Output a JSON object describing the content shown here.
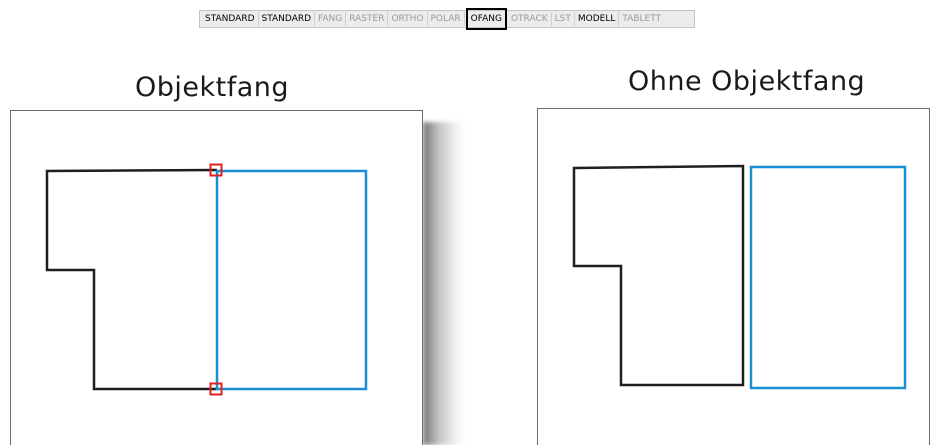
{
  "statusbar": {
    "buttons": [
      {
        "label": "STANDARD",
        "state": "on"
      },
      {
        "label": "STANDARD",
        "state": "on"
      },
      {
        "label": "FANG",
        "state": "off"
      },
      {
        "label": "RASTER",
        "state": "off"
      },
      {
        "label": "ORTHO",
        "state": "off"
      },
      {
        "label": "POLAR",
        "state": "off"
      },
      {
        "label": "OFANG",
        "state": "highlight"
      },
      {
        "label": "OTRACK",
        "state": "off"
      },
      {
        "label": "LST",
        "state": "off"
      },
      {
        "label": "MODELL",
        "state": "on"
      },
      {
        "label": "TABLETT",
        "state": "off"
      }
    ]
  },
  "left_panel": {
    "title": "Objektfang"
  },
  "right_panel": {
    "title": "Ohne Objektfang"
  },
  "colors": {
    "polygon_stroke": "#1f1f1f",
    "rectangle_stroke": "#1a8fd6",
    "snap_marker": "#e02020"
  }
}
